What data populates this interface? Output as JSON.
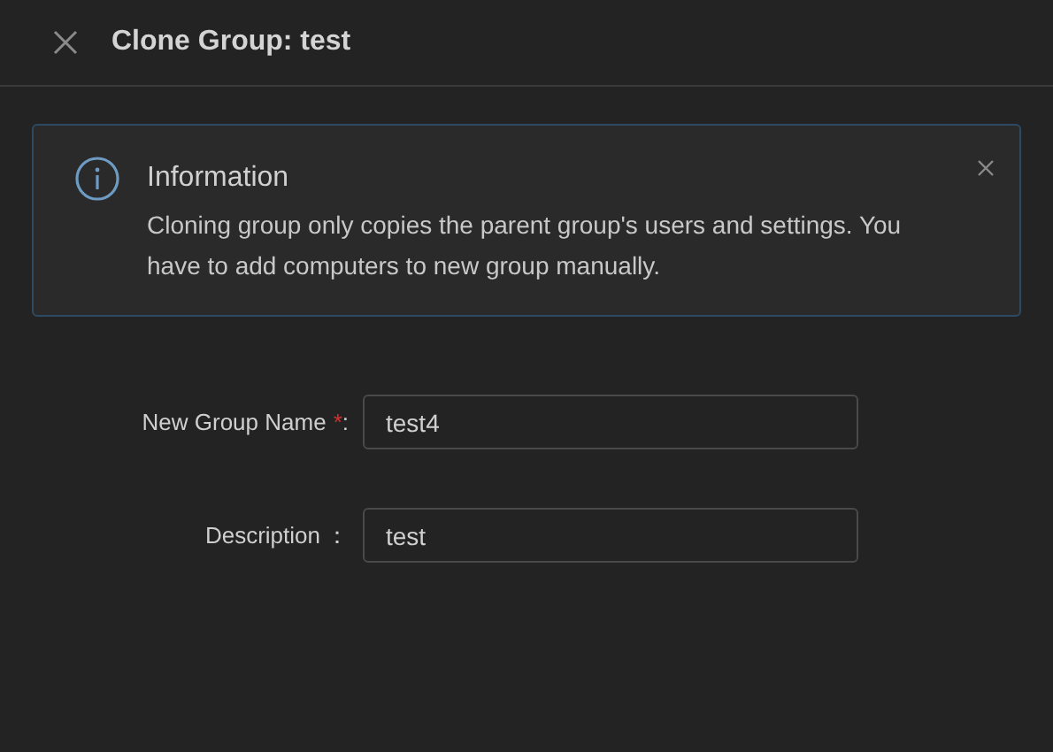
{
  "header": {
    "title": "Clone Group: test"
  },
  "alert": {
    "title": "Information",
    "message": "Cloning group only copies the parent group's users and settings. You have to add computers to new group manually."
  },
  "fields": [
    {
      "label": "New Group Name",
      "required_mark": "*",
      "suffix": ":",
      "value": "test4"
    },
    {
      "label": "Description",
      "suffix": "：",
      "value": "test"
    }
  ]
}
